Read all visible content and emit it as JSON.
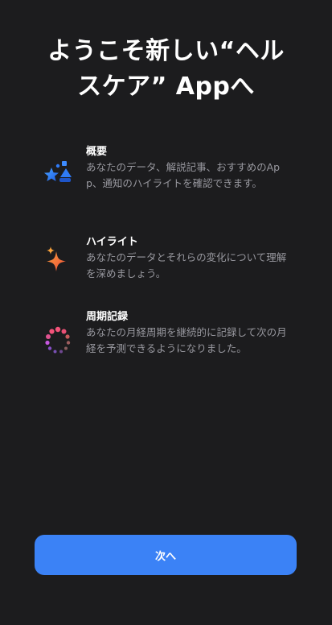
{
  "header": {
    "title_line1": "ようこそ新しい“ヘル",
    "title_line2": "スケア” Appへ"
  },
  "features": [
    {
      "title": "概要",
      "description": "あなたのデータ、解説記事、おすすめのApp、通知のハイライトを確認できます。",
      "icon": "summary-shapes-icon",
      "color": "#2f7bf6"
    },
    {
      "title": "ハイライト",
      "description": "あなたのデータとそれらの変化について理解を深めましょう。",
      "icon": "sparkle-icon",
      "color": "#f26a3a"
    },
    {
      "title": "周期記録",
      "description": "あなたの月経周期を継続的に記録して次の月経を予測できるようになりました。",
      "icon": "cycle-tracking-icon",
      "color": "#f4537a"
    }
  ],
  "footer": {
    "next_label": "次へ"
  },
  "colors": {
    "background": "#1c1c1e",
    "accent": "#3b82f6",
    "secondary_text": "#98989f"
  }
}
